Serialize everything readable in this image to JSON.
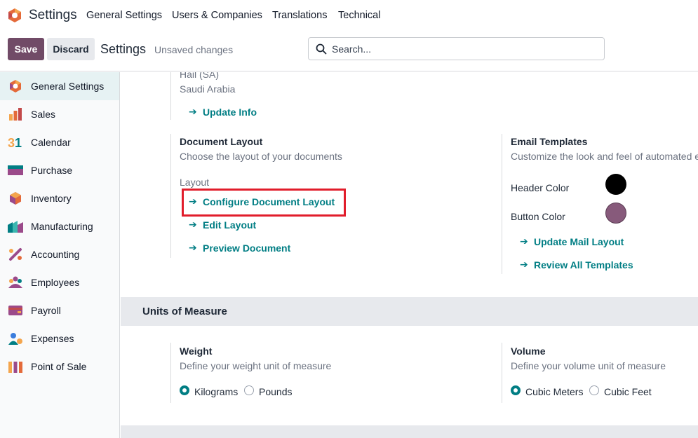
{
  "topnav": {
    "app_title": "Settings",
    "menu": [
      "General Settings",
      "Users & Companies",
      "Translations",
      "Technical"
    ]
  },
  "control_panel": {
    "save_label": "Save",
    "discard_label": "Discard",
    "title": "Settings",
    "status": "Unsaved changes",
    "search_placeholder": "Search..."
  },
  "sidebar": {
    "items": [
      {
        "label": "General Settings",
        "icon": "general-settings-icon",
        "active": true
      },
      {
        "label": "Sales",
        "icon": "sales-icon"
      },
      {
        "label": "Calendar",
        "icon": "calendar-icon"
      },
      {
        "label": "Purchase",
        "icon": "purchase-icon"
      },
      {
        "label": "Inventory",
        "icon": "inventory-icon"
      },
      {
        "label": "Manufacturing",
        "icon": "manufacturing-icon"
      },
      {
        "label": "Accounting",
        "icon": "accounting-icon"
      },
      {
        "label": "Employees",
        "icon": "employees-icon"
      },
      {
        "label": "Payroll",
        "icon": "payroll-icon"
      },
      {
        "label": "Expenses",
        "icon": "expenses-icon"
      },
      {
        "label": "Point of Sale",
        "icon": "point-of-sale-icon"
      }
    ]
  },
  "company": {
    "address_line": "Hail (SA)",
    "country": "Saudi Arabia",
    "update_info": "Update Info"
  },
  "document_layout": {
    "title": "Document Layout",
    "description": "Choose the layout of your documents",
    "layout_label": "Layout",
    "configure": "Configure Document Layout",
    "edit": "Edit Layout",
    "preview": "Preview Document"
  },
  "email_templates": {
    "title": "Email Templates",
    "description": "Customize the look and feel of automated e",
    "header_color_label": "Header Color",
    "header_color": "#000000",
    "button_color_label": "Button Color",
    "button_color": "#875a7b",
    "update_mail_layout": "Update Mail Layout",
    "review_templates": "Review All Templates"
  },
  "units": {
    "section_title": "Units of Measure",
    "weight": {
      "title": "Weight",
      "description": "Define your weight unit of measure",
      "options": [
        "Kilograms",
        "Pounds"
      ],
      "selected": "Kilograms"
    },
    "volume": {
      "title": "Volume",
      "description": "Define your volume unit of measure",
      "options": [
        "Cubic Meters",
        "Cubic Feet"
      ],
      "selected": "Cubic Meters"
    }
  },
  "colors": {
    "brand": "#714b67",
    "link": "#017e84",
    "highlight": "#e11d2b"
  }
}
